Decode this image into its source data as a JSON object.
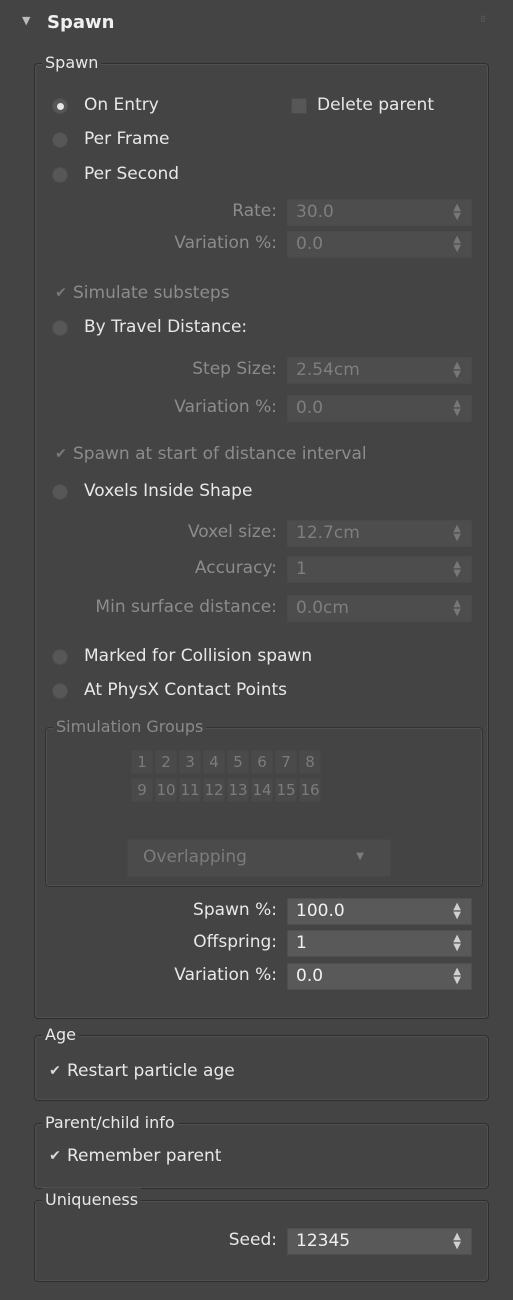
{
  "rollout": {
    "title": "Spawn",
    "expanded": true
  },
  "spawn_group": {
    "title": "Spawn",
    "on_entry": "On Entry",
    "delete_parent": "Delete parent",
    "per_frame": "Per Frame",
    "per_second": "Per Second",
    "rate_label": "Rate:",
    "rate_value": "30.0",
    "variation_label": "Variation %:",
    "variation_value": "0.0",
    "simulate_substeps": "Simulate substeps",
    "by_travel_distance": "By Travel Distance:",
    "step_size_label": "Step Size:",
    "step_size_value": "2.54cm",
    "travel_variation_label": "Variation %:",
    "travel_variation_value": "0.0",
    "spawn_at_start": "Spawn at start of distance interval",
    "voxels_inside_shape": "Voxels Inside Shape",
    "voxel_size_label": "Voxel size:",
    "voxel_size_value": "12.7cm",
    "accuracy_label": "Accuracy:",
    "accuracy_value": "1",
    "min_surface_label": "Min surface distance:",
    "min_surface_value": "0.0cm",
    "marked_for_collision": "Marked for Collision spawn",
    "physx_contact": "At PhysX Contact Points",
    "simulation_groups": {
      "title": "Simulation Groups",
      "row1": [
        "1",
        "2",
        "3",
        "4",
        "5",
        "6",
        "7",
        "8"
      ],
      "row2": [
        "9",
        "10",
        "11",
        "12",
        "13",
        "14",
        "15",
        "16"
      ],
      "mode": "Overlapping"
    },
    "spawn_pct_label": "Spawn %:",
    "spawn_pct_value": "100.0",
    "offspring_label": "Offspring:",
    "offspring_value": "1",
    "offspring_variation_label": "Variation %:",
    "offspring_variation_value": "0.0",
    "selected_mode": "On Entry",
    "delete_parent_checked": false,
    "simulate_substeps_checked": true,
    "spawn_at_start_checked": true
  },
  "age_group": {
    "title": "Age",
    "restart_particle_age": "Restart particle age",
    "checked": true
  },
  "parent_group": {
    "title": "Parent/child info",
    "remember_parent": "Remember parent",
    "checked": true
  },
  "uniqueness_group": {
    "title": "Uniqueness",
    "seed_label": "Seed:",
    "seed_value": "12345"
  }
}
